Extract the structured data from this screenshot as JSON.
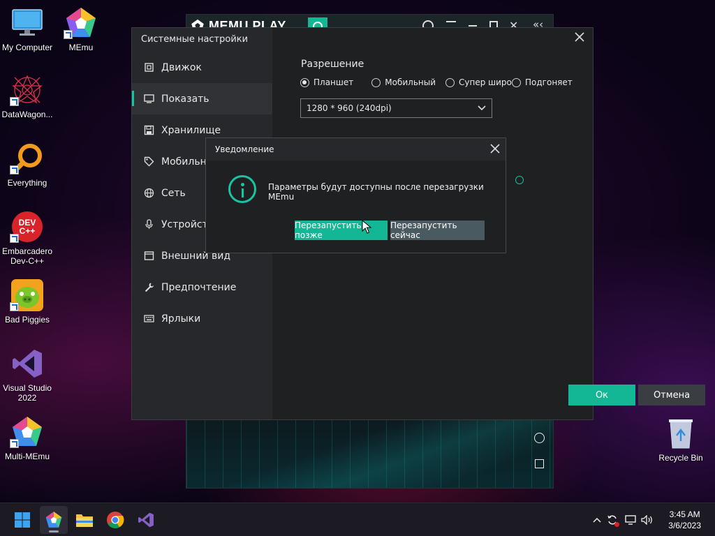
{
  "desktop": {
    "icons": [
      {
        "label": "My Computer"
      },
      {
        "label": "MEmu"
      },
      {
        "label": "DataWagon..."
      },
      {
        "label": "Everything"
      },
      {
        "label": "Embarcadero Dev-C++"
      },
      {
        "label": "Bad Piggies"
      },
      {
        "label": "Visual Studio 2022"
      },
      {
        "label": "Multi-MEmu"
      },
      {
        "label": "Recycle Bin"
      }
    ],
    "devcpp_logo_text": "DEV C++"
  },
  "memu_window": {
    "logo_text": "MEMU PLAY",
    "title_icons": [
      "account-icon",
      "menu-icon",
      "minimize-icon",
      "maximize-icon",
      "close-icon",
      "sidebar-collapse-icon"
    ]
  },
  "settings_dialog": {
    "title": "Системные настройки",
    "nav": [
      {
        "label": "Движок",
        "icon": "chip-icon"
      },
      {
        "label": "Показать",
        "icon": "monitor-icon"
      },
      {
        "label": "Хранилище",
        "icon": "save-icon"
      },
      {
        "label": "Мобильны",
        "icon": "tag-icon"
      },
      {
        "label": "Сеть",
        "icon": "globe-icon"
      },
      {
        "label": "Устройст",
        "icon": "microphone-icon"
      },
      {
        "label": "Внешний вид",
        "icon": "window-icon"
      },
      {
        "label": "Предпочтение",
        "icon": "wrench-icon"
      },
      {
        "label": "Ярлыки",
        "icon": "keyboard-icon"
      }
    ],
    "resolution_title": "Разрешение",
    "resolution_options": [
      {
        "label": "Планшет",
        "selected": true
      },
      {
        "label": "Мобильный",
        "selected": false
      },
      {
        "label": "Супер широк",
        "selected": false
      },
      {
        "label": "Подгоняет",
        "selected": false
      }
    ],
    "resolution_value": "1280 * 960 (240dpi)",
    "ok_label": "Ок",
    "cancel_label": "Отмена",
    "accent_color": "#14b795"
  },
  "notification": {
    "title": "Уведомление",
    "message": "Параметры будут доступны после перезагрузки MEmu",
    "later_label": "Перезапустить позже",
    "now_label": "Перезапустить сейчас"
  },
  "taskbar": {
    "apps": [
      "windows-start-icon",
      "memu-icon",
      "file-explorer-icon",
      "chrome-icon",
      "visual-studio-icon"
    ],
    "tray_icons": [
      "chevron-up-icon",
      "sync-icon",
      "network-icon",
      "volume-icon"
    ],
    "time": "3:45 AM",
    "date": "3/6/2023"
  }
}
